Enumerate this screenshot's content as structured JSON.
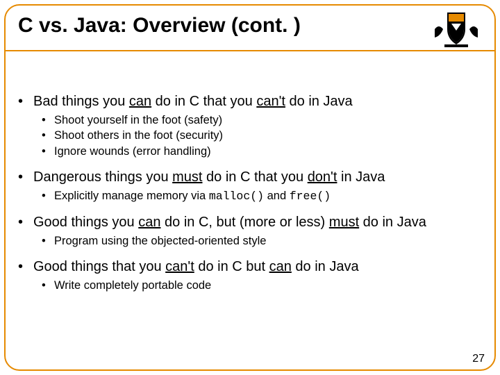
{
  "title": "C vs. Java: Overview (cont. )",
  "page_number": "27",
  "bullets": {
    "p1": {
      "pre": "Bad things you ",
      "u1": "can",
      "mid": " do in C that you ",
      "u2": "can't",
      "post": " do in Java"
    },
    "p1s": [
      "Shoot yourself in the foot (safety)",
      "Shoot others in the foot (security)",
      "Ignore wounds (error handling)"
    ],
    "p2": {
      "pre": "Dangerous things you ",
      "u1": "must",
      "mid": " do in C that you ",
      "u2": "don't",
      "post": " in Java"
    },
    "p2s": {
      "pre": "Explicitly manage memory via ",
      "code1": "malloc()",
      "mid": " and ",
      "code2": "free()"
    },
    "p3": {
      "pre": "Good things you ",
      "u1": "can",
      "mid": " do in C, but (more or less) ",
      "u2": "must",
      "post": " do in Java"
    },
    "p3s": "Program using the objected-oriented style",
    "p4": {
      "pre": "Good things that you ",
      "u1": "can't",
      "mid": " do in C but ",
      "u2": "can",
      "post": " do in Java"
    },
    "p4s": "Write completely portable code"
  }
}
